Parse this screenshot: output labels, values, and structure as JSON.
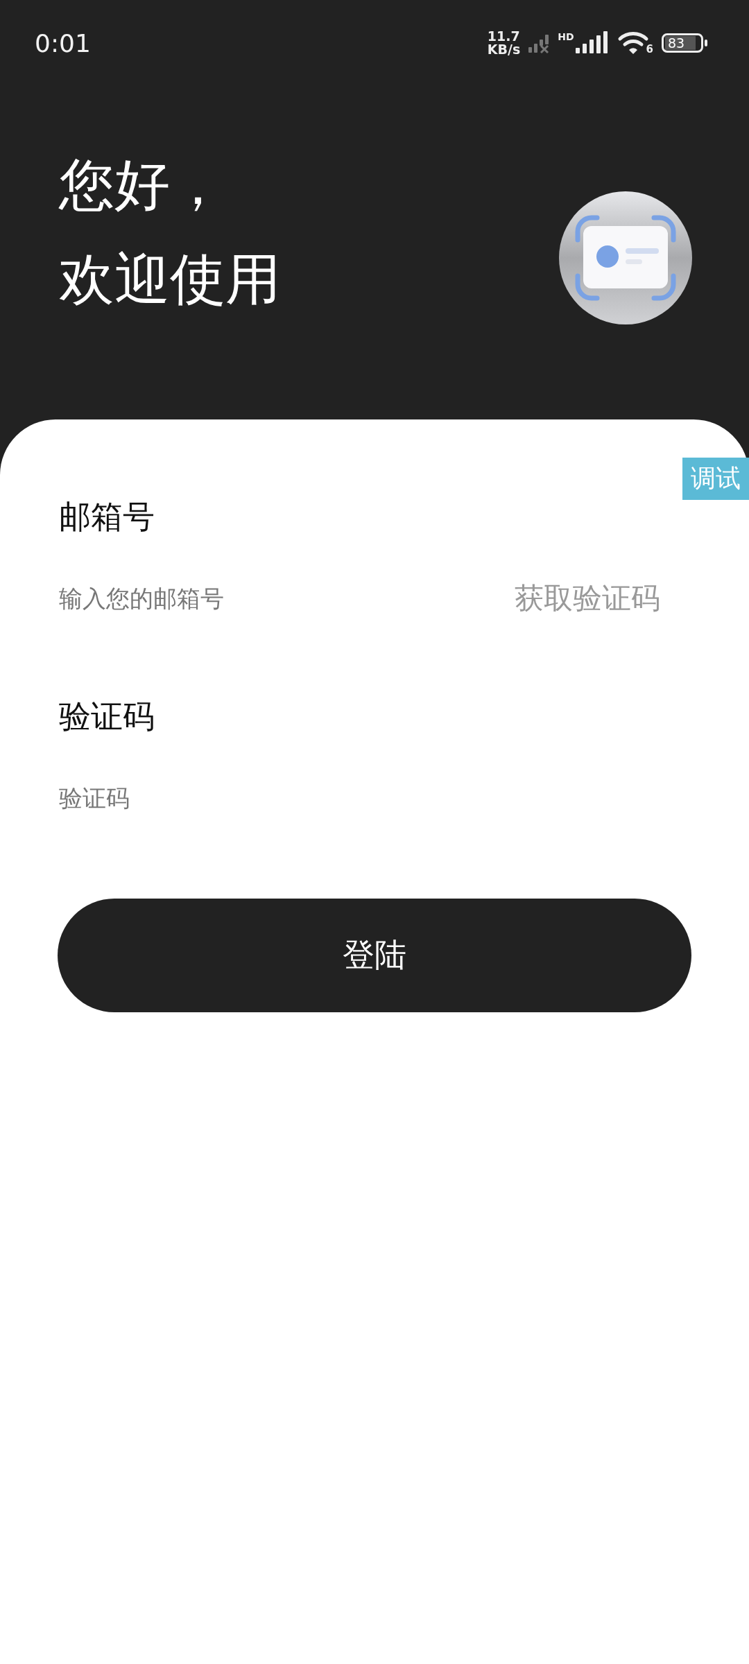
{
  "status_bar": {
    "time": "0:01",
    "net_speed": [
      "11.7",
      "KB/s"
    ],
    "hd_label": "HD",
    "wifi_label": "6",
    "battery": "83"
  },
  "header": {
    "greeting": "您好，",
    "welcome": "欢迎使用"
  },
  "debug_tag": "调试",
  "form": {
    "fields": [
      {
        "label": "邮箱号",
        "placeholder": "输入您的邮箱号",
        "action": "获取验证码"
      },
      {
        "label": "验证码",
        "placeholder": "验证码"
      }
    ],
    "submit": "登陆"
  }
}
